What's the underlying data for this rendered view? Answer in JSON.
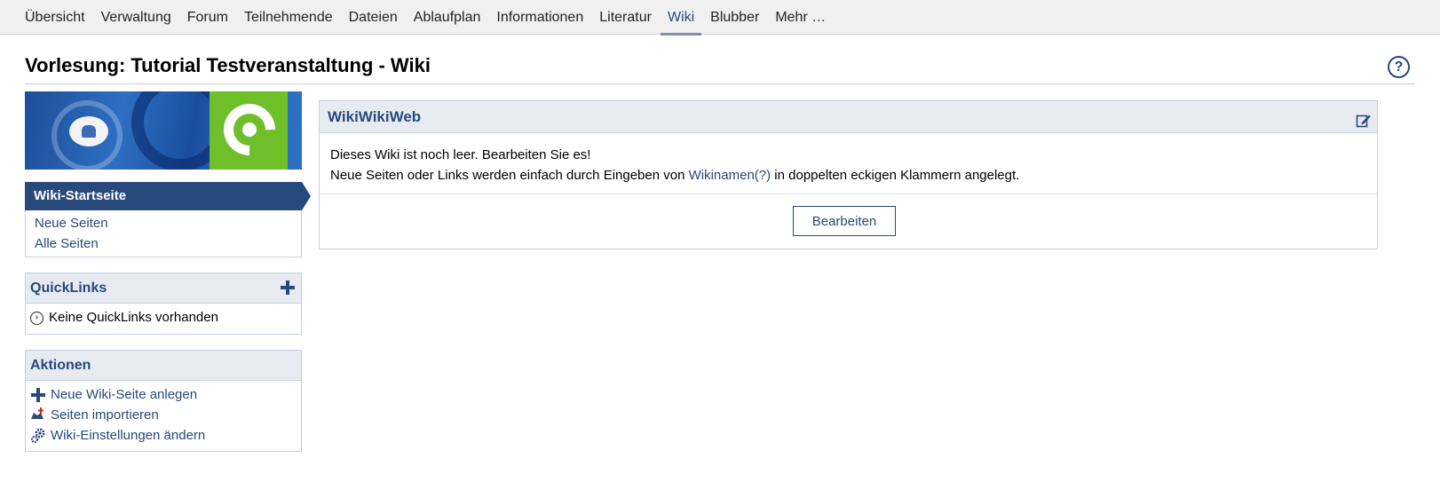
{
  "tabs": [
    {
      "label": "Übersicht",
      "active": false
    },
    {
      "label": "Verwaltung",
      "active": false
    },
    {
      "label": "Forum",
      "active": false
    },
    {
      "label": "Teilnehmende",
      "active": false
    },
    {
      "label": "Dateien",
      "active": false
    },
    {
      "label": "Ablaufplan",
      "active": false
    },
    {
      "label": "Informationen",
      "active": false
    },
    {
      "label": "Literatur",
      "active": false
    },
    {
      "label": "Wiki",
      "active": true
    },
    {
      "label": "Blubber",
      "active": false
    },
    {
      "label": "Mehr …",
      "active": false
    }
  ],
  "page": {
    "title": "Vorlesung: Tutorial Testveranstaltung - Wiki",
    "help_icon": "question-circle-icon",
    "help_glyph": "?"
  },
  "sidebar": {
    "nav": {
      "active": "Wiki-Startseite",
      "links": [
        "Neue Seiten",
        "Alle Seiten"
      ]
    },
    "quicklinks": {
      "title": "QuickLinks",
      "empty": "Keine QuickLinks vorhanden"
    },
    "actions": {
      "title": "Aktionen",
      "items": [
        {
          "label": "Neue Wiki-Seite anlegen",
          "icon": "plus-icon"
        },
        {
          "label": "Seiten importieren",
          "icon": "import-icon"
        },
        {
          "label": "Wiki-Einstellungen ändern",
          "icon": "settings-icon"
        }
      ]
    }
  },
  "content": {
    "title": "WikiWikiWeb",
    "line1": "Dieses Wiki ist noch leer. Bearbeiten Sie es!",
    "line2_prefix": "Neue Seiten oder Links werden einfach durch Eingeben von ",
    "line2_link": "Wikinamen(?)",
    "line2_suffix": " in doppelten eckigen Klammern angelegt.",
    "edit_button": "Bearbeiten"
  },
  "colors": {
    "primary": "#28497c",
    "header_bg": "#e7ebf1",
    "border": "#c6d0dd",
    "topnav_bg": "#f0f0f0"
  }
}
